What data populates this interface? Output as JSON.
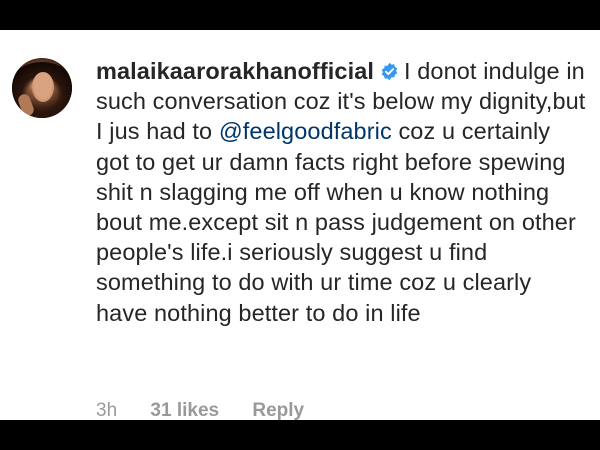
{
  "comment": {
    "username": "malaikaarorakhanofficial",
    "verified_icon": "verified-badge-icon",
    "text_before_mention": "I donot indulge in such conversation coz it's below my dignity,but I jus had to",
    "mention": "@feelgoodfabric",
    "text_after_mention": "coz u certainly got to get ur damn facts right before spewing shit n slagging me off when u know nothing bout me.except sit n pass judgement on other people's life.i seriously suggest u find something to do with ur time coz u clearly have nothing better to do in life"
  },
  "meta": {
    "time": "3h",
    "likes": "31 likes",
    "reply": "Reply"
  },
  "colors": {
    "text": "#262626",
    "mention": "#003569",
    "verified": "#3897f0",
    "meta": "#999999"
  }
}
